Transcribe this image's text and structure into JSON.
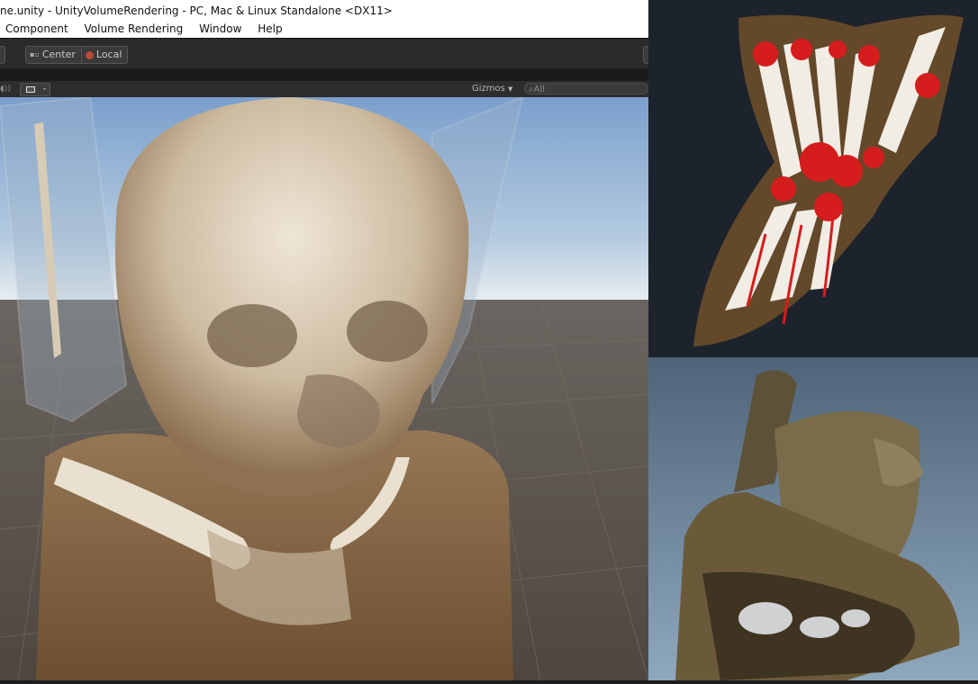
{
  "window": {
    "title": "ne.unity - UnityVolumeRendering - PC, Mac & Linux Standalone <DX11>"
  },
  "menu": {
    "items": [
      "Component",
      "Volume Rendering",
      "Window",
      "Help"
    ]
  },
  "toolbar": {
    "center_label": "Center",
    "local_label": "Local"
  },
  "scene": {
    "gizmos_label": "Gizmos",
    "search_placeholder": "All",
    "audio_icon": "audio-icon",
    "effects_icon": "image-icon"
  },
  "colors": {
    "sky": "#8fb0d6",
    "ground": "#5a524b",
    "skin": "#8a6a45",
    "bone": "#e6dccb",
    "vessels": "#d51d1d"
  }
}
